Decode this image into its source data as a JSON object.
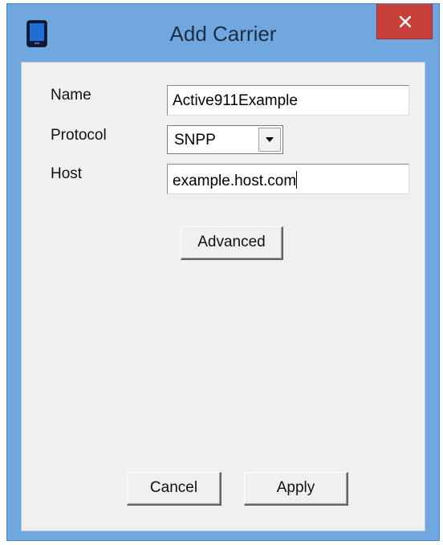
{
  "window": {
    "title": "Add Carrier",
    "close_glyph": "×",
    "app_icon": "mobile-phone-icon",
    "accent_color": "#6fa7de",
    "close_color": "#c7403a"
  },
  "form": {
    "name_label": "Name",
    "name_value": "Active911Example",
    "protocol_label": "Protocol",
    "protocol_value": "SNPP",
    "host_label": "Host",
    "host_value": "example.host.com"
  },
  "buttons": {
    "advanced": "Advanced",
    "cancel": "Cancel",
    "apply": "Apply"
  }
}
